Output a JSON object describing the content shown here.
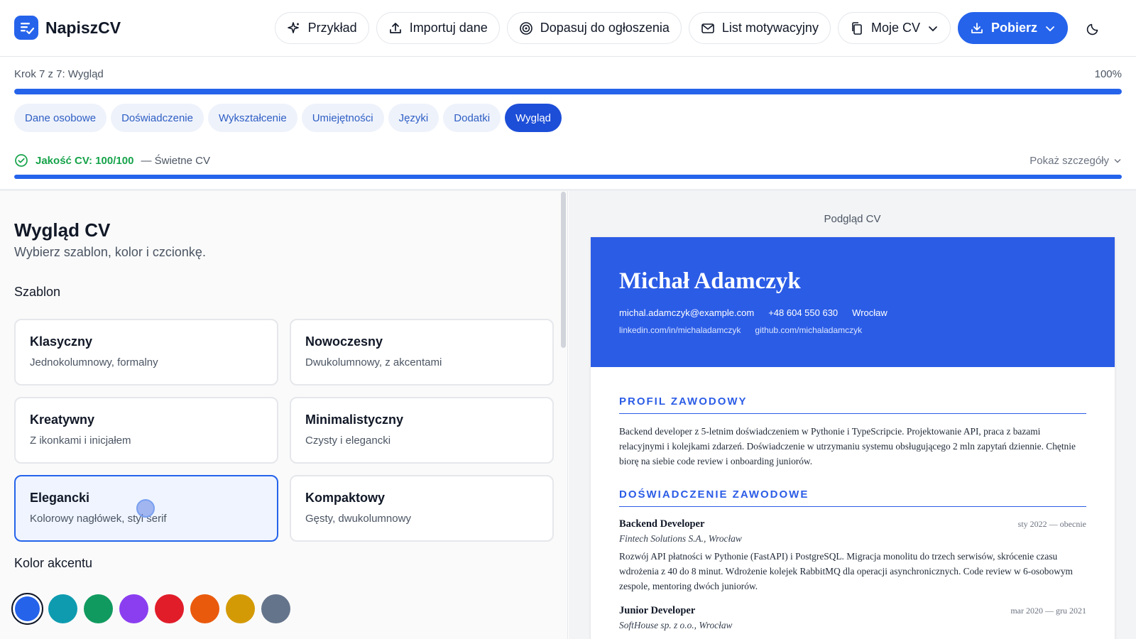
{
  "app": {
    "name": "NapiszCV"
  },
  "nav": {
    "example": "Przykład",
    "import": "Importuj dane",
    "match": "Dopasuj do ogłoszenia",
    "letter": "List motywacyjny",
    "mycv": "Moje CV",
    "download": "Pobierz"
  },
  "progress": {
    "step_label": "Krok 7 z 7: Wygląd",
    "percent_label": "100%",
    "percent": 100
  },
  "tabs": [
    {
      "label": "Dane osobowe"
    },
    {
      "label": "Doświadczenie"
    },
    {
      "label": "Wykształcenie"
    },
    {
      "label": "Umiejętności"
    },
    {
      "label": "Języki"
    },
    {
      "label": "Dodatki"
    },
    {
      "label": "Wygląd",
      "active": true
    }
  ],
  "quality": {
    "score": "Jakość CV: 100/100",
    "label": "— Świetne CV",
    "details": "Pokaż szczegóły",
    "value": 100
  },
  "editor": {
    "title": "Wygląd CV",
    "subtitle": "Wybierz szablon, kolor i czcionkę.",
    "template_label": "Szablon",
    "color_label": "Kolor akcentu",
    "templates": [
      {
        "name": "Klasyczny",
        "desc": "Jednokolumnowy, formalny"
      },
      {
        "name": "Nowoczesny",
        "desc": "Dwukolumnowy, z akcentami"
      },
      {
        "name": "Kreatywny",
        "desc": "Z ikonkami i inicjałem"
      },
      {
        "name": "Minimalistyczny",
        "desc": "Czysty i elegancki"
      },
      {
        "name": "Elegancki",
        "desc": "Kolorowy nagłówek, styl serif",
        "selected": true
      },
      {
        "name": "Kompaktowy",
        "desc": "Gęsty, dwukolumnowy"
      }
    ],
    "colors": [
      "#2563eb",
      "#0e9bb0",
      "#119a5f",
      "#8b3ef0",
      "#e11d2a",
      "#ea5a0c",
      "#d49a06",
      "#64748b"
    ],
    "selected_color": "#2563eb"
  },
  "preview": {
    "label": "Podgląd CV",
    "accent": "#2b5ce6",
    "name": "Michał Adamczyk",
    "email": "michal.adamczyk@example.com",
    "phone": "+48 604 550 630",
    "city": "Wrocław",
    "linkedin": "linkedin.com/in/michaladamczyk",
    "github": "github.com/michaladamczyk",
    "profile_heading": "PROFIL ZAWODOWY",
    "profile_text": "Backend developer z 5-letnim doświadczeniem w Pythonie i TypeScripcie. Projektowanie API, praca z bazami relacyjnymi i kolejkami zdarzeń. Doświadczenie w utrzymaniu systemu obsługującego 2 mln zapytań dziennie. Chętnie biorę na siebie code review i onboarding juniorów.",
    "experience_heading": "DOŚWIADCZENIE ZAWODOWE",
    "jobs": [
      {
        "title": "Backend Developer",
        "date": "sty 2022 — obecnie",
        "company": "Fintech Solutions S.A., Wrocław",
        "desc": "Rozwój API płatności w Pythonie (FastAPI) i PostgreSQL. Migracja monolitu do trzech serwisów, skrócenie czasu wdrożenia z 40 do 8 minut. Wdrożenie kolejek RabbitMQ dla operacji asynchronicznych. Code review w 6-osobowym zespole, mentoring dwóch juniorów."
      },
      {
        "title": "Junior Developer",
        "date": "mar 2020 — gru 2021",
        "company": "SoftHouse sp. z o.o., Wrocław",
        "desc": ""
      }
    ]
  }
}
